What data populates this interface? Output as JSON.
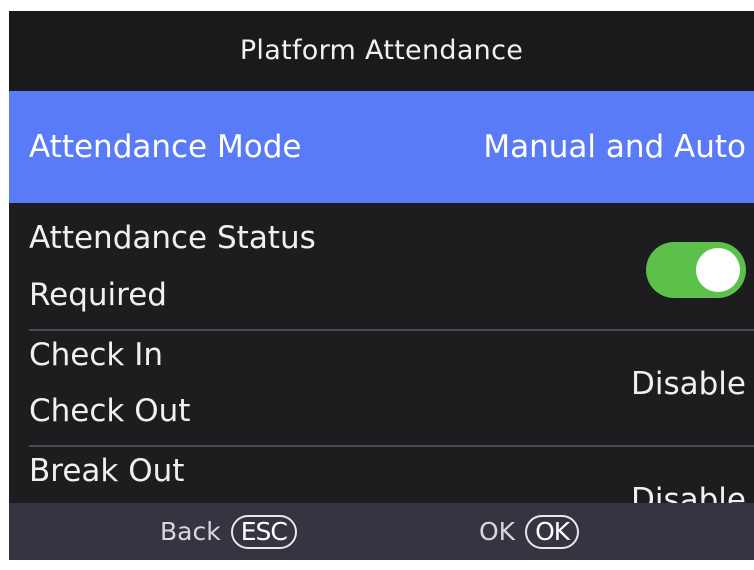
{
  "header": {
    "title": "Platform Attendance"
  },
  "attendance_mode": {
    "label": "Attendance Mode",
    "value": "Manual and Auto"
  },
  "attendance_status_required": {
    "label_line1": "Attendance Status",
    "label_line2": "Required",
    "toggle_state": "on"
  },
  "check_in_out": {
    "label_line1": "Check In",
    "label_line2": "Check Out",
    "value": "Disable"
  },
  "break_out": {
    "label_line1": "Break Out",
    "value": "Disable"
  },
  "footer": {
    "back_label": "Back",
    "back_key": "ESC",
    "ok_label": "OK",
    "ok_key": "OK"
  },
  "colors": {
    "highlight": "#5a7bf7",
    "toggle_on": "#5cc14a",
    "background": "#1d1d1f",
    "footer": "#343541"
  }
}
